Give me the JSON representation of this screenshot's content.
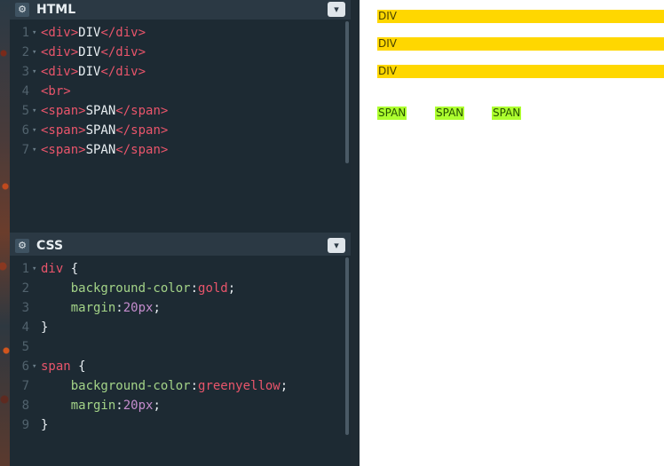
{
  "html_panel": {
    "title": "HTML",
    "lines": [
      {
        "n": "1",
        "fold": true,
        "parts": [
          [
            "tag",
            "<div>"
          ],
          [
            "txt",
            "DIV"
          ],
          [
            "tag",
            "</div>"
          ]
        ]
      },
      {
        "n": "2",
        "fold": true,
        "parts": [
          [
            "tag",
            "<div>"
          ],
          [
            "txt",
            "DIV"
          ],
          [
            "tag",
            "</div>"
          ]
        ]
      },
      {
        "n": "3",
        "fold": true,
        "parts": [
          [
            "tag",
            "<div>"
          ],
          [
            "txt",
            "DIV"
          ],
          [
            "tag",
            "</div>"
          ]
        ]
      },
      {
        "n": "4",
        "fold": false,
        "parts": [
          [
            "tag",
            "<br>"
          ]
        ]
      },
      {
        "n": "5",
        "fold": true,
        "parts": [
          [
            "tag",
            "<span>"
          ],
          [
            "txt",
            "SPAN"
          ],
          [
            "tag",
            "</span>"
          ]
        ]
      },
      {
        "n": "6",
        "fold": true,
        "parts": [
          [
            "tag",
            "<span>"
          ],
          [
            "txt",
            "SPAN"
          ],
          [
            "tag",
            "</span>"
          ]
        ]
      },
      {
        "n": "7",
        "fold": true,
        "parts": [
          [
            "tag",
            "<span>"
          ],
          [
            "txt",
            "SPAN"
          ],
          [
            "tag",
            "</span>"
          ]
        ]
      }
    ]
  },
  "css_panel": {
    "title": "CSS",
    "lines": [
      {
        "n": "1",
        "fold": true,
        "parts": [
          [
            "tag",
            "div"
          ],
          [
            "punc",
            " {"
          ]
        ]
      },
      {
        "n": "2",
        "fold": false,
        "parts": [
          [
            "punc",
            "    "
          ],
          [
            "prop",
            "background-color"
          ],
          [
            "punc",
            ":"
          ],
          [
            "val-kw",
            "gold"
          ],
          [
            "punc",
            ";"
          ]
        ]
      },
      {
        "n": "3",
        "fold": false,
        "parts": [
          [
            "punc",
            "    "
          ],
          [
            "prop",
            "margin"
          ],
          [
            "punc",
            ":"
          ],
          [
            "val-num",
            "20px"
          ],
          [
            "punc",
            ";"
          ]
        ]
      },
      {
        "n": "4",
        "fold": false,
        "parts": [
          [
            "punc",
            "}"
          ]
        ]
      },
      {
        "n": "5",
        "fold": false,
        "parts": []
      },
      {
        "n": "6",
        "fold": true,
        "parts": [
          [
            "tag",
            "span"
          ],
          [
            "punc",
            " {"
          ]
        ]
      },
      {
        "n": "7",
        "fold": false,
        "parts": [
          [
            "punc",
            "    "
          ],
          [
            "prop",
            "background-color"
          ],
          [
            "punc",
            ":"
          ],
          [
            "val-kw",
            "greenyellow"
          ],
          [
            "punc",
            ";"
          ]
        ]
      },
      {
        "n": "8",
        "fold": false,
        "parts": [
          [
            "punc",
            "    "
          ],
          [
            "prop",
            "margin"
          ],
          [
            "punc",
            ":"
          ],
          [
            "val-num",
            "20px"
          ],
          [
            "punc",
            ";"
          ]
        ]
      },
      {
        "n": "9",
        "fold": false,
        "parts": [
          [
            "punc",
            "}"
          ]
        ]
      }
    ]
  },
  "icons": {
    "settings": "gear-icon",
    "collapse": "chevron-down-icon"
  },
  "preview": {
    "divs": [
      "DIV",
      "DIV",
      "DIV"
    ],
    "spans": [
      "SPAN",
      "SPAN",
      "SPAN"
    ]
  },
  "colors": {
    "editor_bg": "#1d2a33",
    "tag": "#e9556b",
    "property": "#a4d488",
    "number": "#c48ccd",
    "div_bg": "gold",
    "span_bg": "greenyellow"
  }
}
